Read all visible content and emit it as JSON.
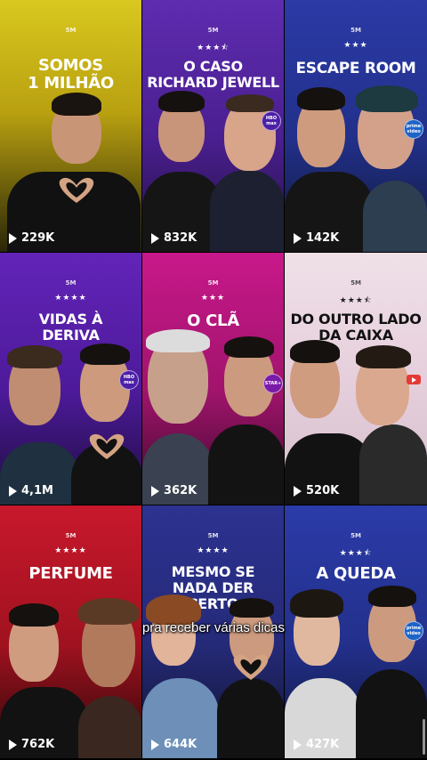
{
  "brand": "5M",
  "caption": "pra receber várias dicas",
  "tiles": [
    {
      "title_l1": "SOMOS",
      "title_l2": "1 MILHÃO",
      "stars": "",
      "views": "229K",
      "badge": ""
    },
    {
      "title_l1": "O CASO",
      "title_l2": "RICHARD JEWELL",
      "stars": "★★★⯪",
      "views": "832K",
      "badge": "HBO max"
    },
    {
      "title_l1": "ESCAPE ROOM",
      "title_l2": "",
      "stars": "★★★",
      "views": "142K",
      "badge": "prime video"
    },
    {
      "title_l1": "VIDAS À",
      "title_l2": "DERIVA",
      "stars": "★★★★",
      "views": "4,1M",
      "badge": "HBO max"
    },
    {
      "title_l1": "O CLÃ",
      "title_l2": "",
      "stars": "★★★",
      "views": "362K",
      "badge": "STAR+"
    },
    {
      "title_l1": "DO OUTRO LADO",
      "title_l2": "DA CAIXA",
      "stars": "★★★⯪",
      "views": "520K",
      "badge": "youtube"
    },
    {
      "title_l1": "PERFUME",
      "title_l2": "",
      "stars": "★★★★",
      "views": "762K",
      "badge": ""
    },
    {
      "title_l1": "MESMO SE",
      "title_l2": "NADA DER CERTO",
      "stars": "★★★★",
      "views": "644K",
      "badge": ""
    },
    {
      "title_l1": "A QUEDA",
      "title_l2": "",
      "stars": "★★★⯪",
      "views": "427K",
      "badge": "prime video"
    }
  ],
  "colors": {
    "tile1": "#d4c21a",
    "tile2": "#5a2aa8",
    "tile3": "#2a3aa0",
    "tile4": "#5b1fb0",
    "tile5": "#c0187e",
    "tile6": "#e8d6e0",
    "tile7": "#c0182a",
    "tile8": "#2a2f8c",
    "tile9": "#2a3aa6"
  },
  "icons": {
    "play": "play-icon",
    "heart": "heart-hands-icon"
  }
}
